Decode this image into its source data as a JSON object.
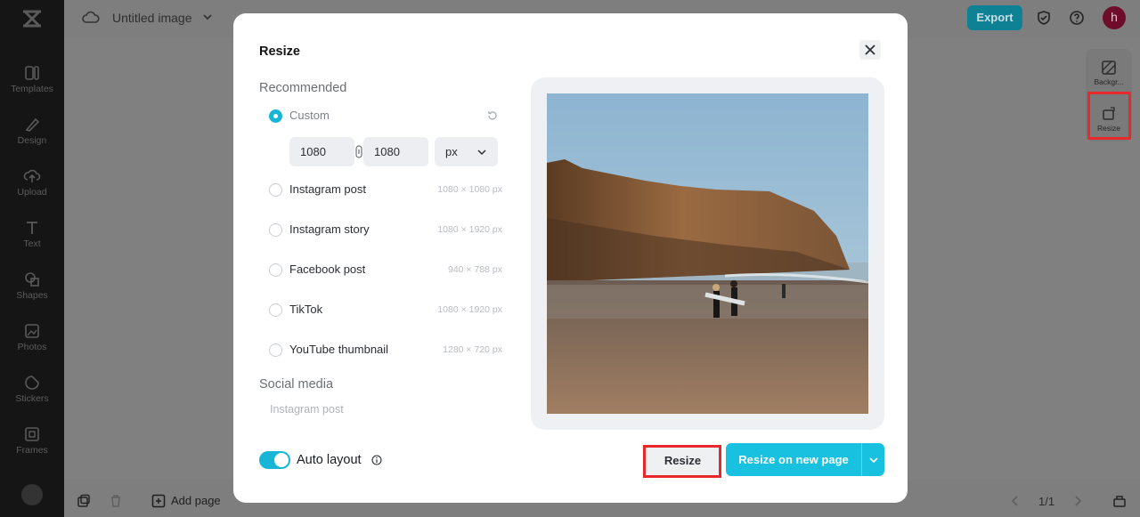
{
  "app": {
    "doc_title": "Untitled image",
    "export_label": "Export",
    "avatar_initial": "h",
    "brand_color": "#17c1df"
  },
  "sidebar": {
    "items": [
      {
        "label": "Templates",
        "icon": "templates-icon"
      },
      {
        "label": "Design",
        "icon": "design-icon"
      },
      {
        "label": "Upload",
        "icon": "upload-icon"
      },
      {
        "label": "Text",
        "icon": "text-icon"
      },
      {
        "label": "Shapes",
        "icon": "shapes-icon"
      },
      {
        "label": "Photos",
        "icon": "photos-icon"
      },
      {
        "label": "Stickers",
        "icon": "stickers-icon"
      },
      {
        "label": "Frames",
        "icon": "frames-icon"
      }
    ]
  },
  "right_panel": {
    "items": [
      {
        "label": "Backgr...",
        "icon": "background-icon"
      },
      {
        "label": "Resize",
        "icon": "resize-icon"
      }
    ]
  },
  "bottom_bar": {
    "add_page_label": "Add page",
    "page_count": "1/1"
  },
  "modal": {
    "title": "Resize",
    "recommended_label": "Recommended",
    "custom": {
      "label": "Custom",
      "width": "1080",
      "height": "1080",
      "unit": "px",
      "selected": true
    },
    "presets": [
      {
        "label": "Instagram post",
        "dims": "1080 × 1080 px"
      },
      {
        "label": "Instagram story",
        "dims": "1080 × 1920 px"
      },
      {
        "label": "Facebook post",
        "dims": "940 × 788 px"
      },
      {
        "label": "TikTok",
        "dims": "1080 × 1920 px"
      },
      {
        "label": "YouTube thumbnail",
        "dims": "1280 × 720 px"
      }
    ],
    "social_media_label": "Social media",
    "social_media_first": "Instagram post",
    "auto_layout_label": "Auto layout",
    "auto_layout_on": true,
    "resize_label": "Resize",
    "resize_new_page_label": "Resize on new page"
  }
}
